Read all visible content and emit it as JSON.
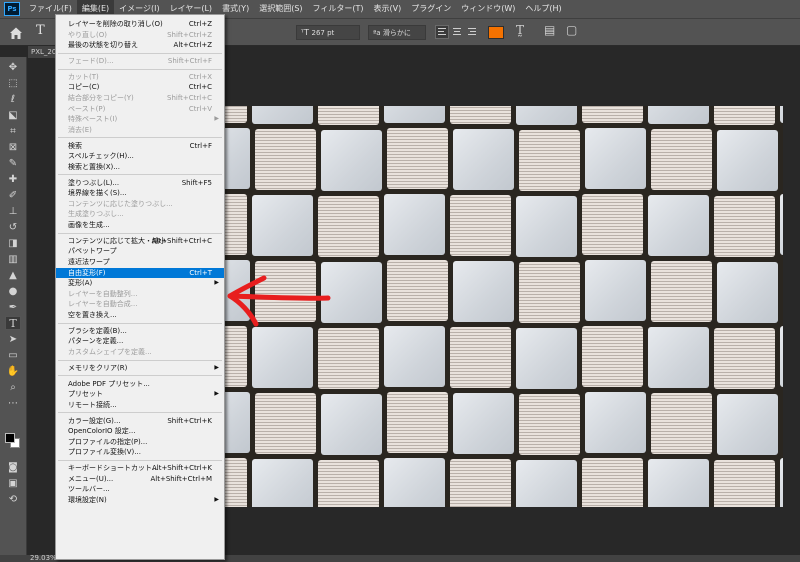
{
  "menubar": {
    "logo": "Ps",
    "items": [
      "ファイル(F)",
      "編集(E)",
      "イメージ(I)",
      "レイヤー(L)",
      "書式(Y)",
      "選択範囲(S)",
      "フィルター(T)",
      "表示(V)",
      "プラグイン",
      "ウィンドウ(W)",
      "ヘルプ(H)"
    ]
  },
  "options": {
    "font_size": "267 pt",
    "antialias": "滑らかに",
    "text_color": "#f57200"
  },
  "document": {
    "tab_label": "PXL_20",
    "zoom": "29.03%"
  },
  "edit_menu": {
    "highlight_color": "#0078d7",
    "items": [
      {
        "label": "レイヤーを削除の取り消し(O)",
        "shortcut": "Ctrl+Z",
        "disabled": false
      },
      {
        "label": "やり直し(O)",
        "shortcut": "Shift+Ctrl+Z",
        "disabled": true
      },
      {
        "label": "最後の状態を切り替え",
        "shortcut": "Alt+Ctrl+Z",
        "disabled": false
      },
      {
        "label": "フェード(D)...",
        "shortcut": "Shift+Ctrl+F",
        "disabled": true
      },
      {
        "label": "カット(T)",
        "shortcut": "Ctrl+X",
        "disabled": true
      },
      {
        "label": "コピー(C)",
        "shortcut": "Ctrl+C",
        "disabled": false
      },
      {
        "label": "結合部分をコピー(Y)",
        "shortcut": "Shift+Ctrl+C",
        "disabled": true
      },
      {
        "label": "ペースト(P)",
        "shortcut": "Ctrl+V",
        "disabled": true
      },
      {
        "label": "特殊ペースト(I)",
        "shortcut": "",
        "disabled": true,
        "submenu": true
      },
      {
        "label": "消去(E)",
        "shortcut": "",
        "disabled": true
      },
      {
        "label": "検索",
        "shortcut": "Ctrl+F",
        "disabled": false
      },
      {
        "label": "スペルチェック(H)...",
        "shortcut": "",
        "disabled": false
      },
      {
        "label": "検索と置換(X)...",
        "shortcut": "",
        "disabled": false
      },
      {
        "label": "塗りつぶし(L)...",
        "shortcut": "Shift+F5",
        "disabled": false
      },
      {
        "label": "境界線を描く(S)...",
        "shortcut": "",
        "disabled": false
      },
      {
        "label": "コンテンツに応じた塗りつぶし...",
        "shortcut": "",
        "disabled": true
      },
      {
        "label": "生成塗りつぶし...",
        "shortcut": "",
        "disabled": true
      },
      {
        "label": "画像を生成...",
        "shortcut": "",
        "disabled": false
      },
      {
        "label": "コンテンツに応じて拡大・縮小",
        "shortcut": "Alt+Shift+Ctrl+C",
        "disabled": false
      },
      {
        "label": "パペットワープ",
        "shortcut": "",
        "disabled": false
      },
      {
        "label": "遠近法ワープ",
        "shortcut": "",
        "disabled": false
      },
      {
        "label": "自由変形(F)",
        "shortcut": "Ctrl+T",
        "disabled": false,
        "highlighted": true
      },
      {
        "label": "変形(A)",
        "shortcut": "",
        "disabled": false,
        "submenu": true
      },
      {
        "label": "レイヤーを自動整列...",
        "shortcut": "",
        "disabled": true
      },
      {
        "label": "レイヤーを自動合成...",
        "shortcut": "",
        "disabled": true
      },
      {
        "label": "空を置き換え...",
        "shortcut": "",
        "disabled": false
      },
      {
        "label": "ブラシを定義(B)...",
        "shortcut": "",
        "disabled": false
      },
      {
        "label": "パターンを定義...",
        "shortcut": "",
        "disabled": false
      },
      {
        "label": "カスタムシェイプを定義...",
        "shortcut": "",
        "disabled": true
      },
      {
        "label": "メモリをクリア(R)",
        "shortcut": "",
        "disabled": false,
        "submenu": true
      },
      {
        "label": "Adobe PDF プリセット...",
        "shortcut": "",
        "disabled": false
      },
      {
        "label": "プリセット",
        "shortcut": "",
        "disabled": false,
        "submenu": true
      },
      {
        "label": "リモート接続...",
        "shortcut": "",
        "disabled": false
      },
      {
        "label": "カラー設定(G)...",
        "shortcut": "Shift+Ctrl+K",
        "disabled": false
      },
      {
        "label": "OpenColorIO 設定...",
        "shortcut": "",
        "disabled": false
      },
      {
        "label": "プロファイルの指定(P)...",
        "shortcut": "",
        "disabled": false
      },
      {
        "label": "プロファイル変換(V)...",
        "shortcut": "",
        "disabled": false
      },
      {
        "label": "キーボードショートカット...",
        "shortcut": "Alt+Shift+Ctrl+K",
        "disabled": false
      },
      {
        "label": "メニュー(U)...",
        "shortcut": "Alt+Shift+Ctrl+M",
        "disabled": false
      },
      {
        "label": "ツールバー...",
        "shortcut": "",
        "disabled": false
      },
      {
        "label": "環境設定(N)",
        "shortcut": "",
        "disabled": false,
        "submenu": true
      }
    ]
  },
  "annotation": {
    "arrow_color": "#e81e1e"
  }
}
